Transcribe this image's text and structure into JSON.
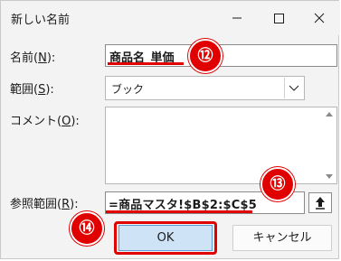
{
  "window": {
    "title": "新しい名前",
    "minimize_icon": "minimize-icon",
    "maximize_icon": "maximize-icon",
    "close_icon": "close-icon"
  },
  "form": {
    "name_label": "名前(",
    "name_key": "N",
    "name_label_end": "):",
    "name_value": "商品名_単価",
    "scope_label": "範囲(",
    "scope_key": "S",
    "scope_label_end": "):",
    "scope_value": "ブック",
    "comment_label": "コメント(",
    "comment_key": "O",
    "comment_label_end": "):",
    "comment_value": "",
    "ref_label": "参照範囲(",
    "ref_key": "R",
    "ref_label_end": "):",
    "ref_value": "=商品マスタ!$B$2:$C$5"
  },
  "buttons": {
    "ok": "OK",
    "cancel": "キャンセル"
  },
  "annotations": {
    "badge_12": "⑫",
    "badge_13": "⑬",
    "badge_14": "⑭",
    "accent_color": "#e00000"
  }
}
